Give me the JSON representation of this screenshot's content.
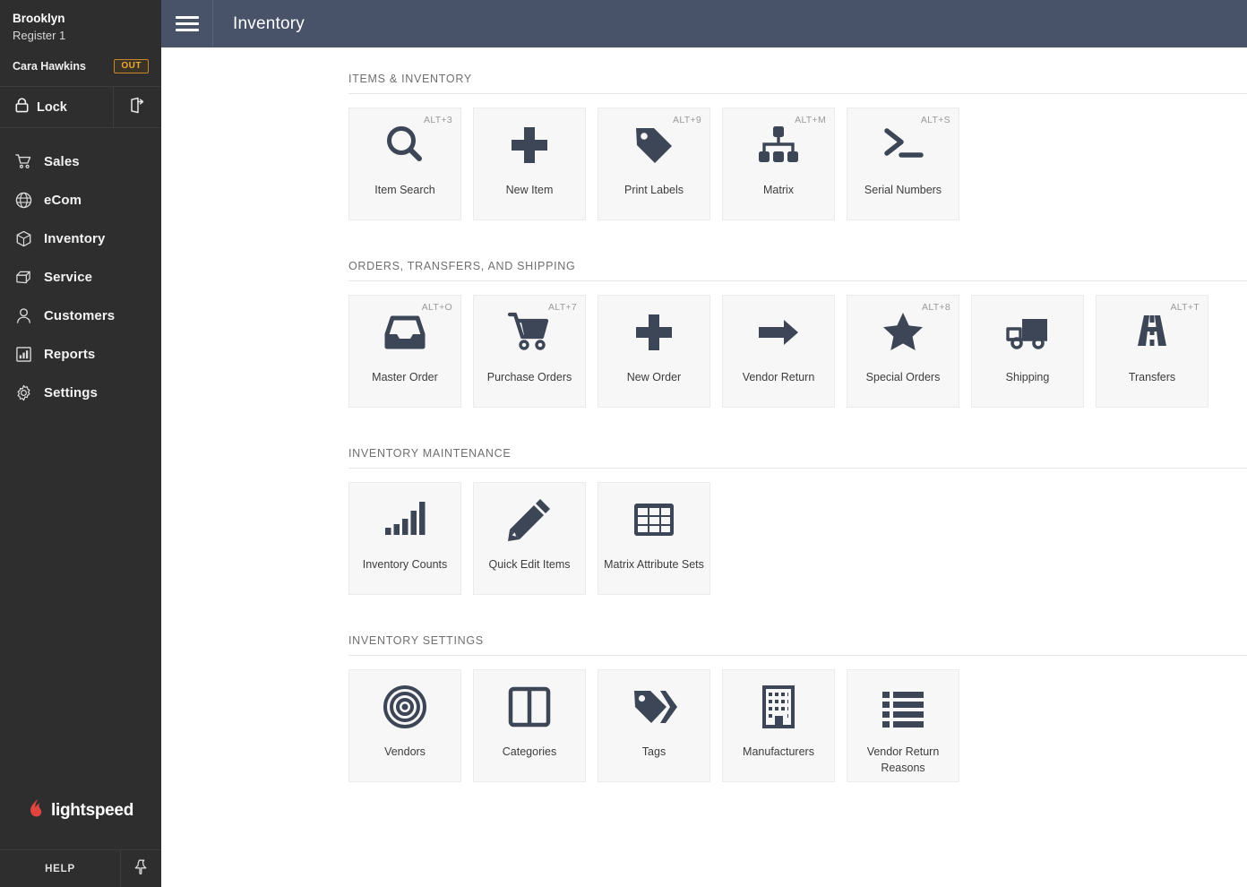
{
  "sidebar": {
    "store_name": "Brooklyn",
    "register": "Register 1",
    "user_name": "Cara Hawkins",
    "status_badge": "OUT",
    "lock_label": "Lock",
    "logout_icon": "logout-icon",
    "nav_items": [
      {
        "label": "Sales",
        "icon": "shopping-cart-icon"
      },
      {
        "label": "eCom",
        "icon": "globe-icon"
      },
      {
        "label": "Inventory",
        "icon": "box-icon"
      },
      {
        "label": "Service",
        "icon": "toolbox-icon"
      },
      {
        "label": "Customers",
        "icon": "person-icon"
      },
      {
        "label": "Reports",
        "icon": "bar-chart-icon"
      },
      {
        "label": "Settings",
        "icon": "gear-icon"
      }
    ],
    "brand": "lightspeed",
    "brand_color": "#e0443e",
    "help_label": "HELP",
    "pin_icon": "pushpin-icon"
  },
  "header": {
    "menu_icon": "hamburger-menu-icon",
    "title": "Inventory",
    "background": "#48536a"
  },
  "sections": [
    {
      "title": "ITEMS & INVENTORY",
      "tiles": [
        {
          "label": "Item Search",
          "shortcut": "ALT+3",
          "icon": "magnifier-icon"
        },
        {
          "label": "New Item",
          "shortcut": "",
          "icon": "plus-icon"
        },
        {
          "label": "Print Labels",
          "shortcut": "ALT+9",
          "icon": "tag-icon"
        },
        {
          "label": "Matrix",
          "shortcut": "ALT+M",
          "icon": "sitemap-icon"
        },
        {
          "label": "Serial Numbers",
          "shortcut": "ALT+S",
          "icon": "terminal-icon"
        }
      ]
    },
    {
      "title": "ORDERS, TRANSFERS, AND SHIPPING",
      "tiles": [
        {
          "label": "Master Order",
          "shortcut": "ALT+O",
          "icon": "inbox-tray-icon"
        },
        {
          "label": "Purchase Orders",
          "shortcut": "ALT+7",
          "icon": "shopping-cart-icon"
        },
        {
          "label": "New Order",
          "shortcut": "",
          "icon": "plus-icon"
        },
        {
          "label": "Vendor Return",
          "shortcut": "",
          "icon": "arrow-right-icon"
        },
        {
          "label": "Special Orders",
          "shortcut": "ALT+8",
          "icon": "star-icon"
        },
        {
          "label": "Shipping",
          "shortcut": "",
          "icon": "truck-icon"
        },
        {
          "label": "Transfers",
          "shortcut": "ALT+T",
          "icon": "road-icon"
        }
      ]
    },
    {
      "title": "INVENTORY MAINTENANCE",
      "tiles": [
        {
          "label": "Inventory Counts",
          "shortcut": "",
          "icon": "bar-chart-icon"
        },
        {
          "label": "Quick Edit Items",
          "shortcut": "",
          "icon": "pencil-icon"
        },
        {
          "label": "Matrix Attribute Sets",
          "shortcut": "",
          "icon": "grid-table-icon"
        }
      ]
    },
    {
      "title": "INVENTORY SETTINGS",
      "tiles": [
        {
          "label": "Vendors",
          "shortcut": "",
          "icon": "bullseye-icon"
        },
        {
          "label": "Categories",
          "shortcut": "",
          "icon": "columns-icon"
        },
        {
          "label": "Tags",
          "shortcut": "",
          "icon": "double-tag-icon"
        },
        {
          "label": "Manufacturers",
          "shortcut": "",
          "icon": "building-icon"
        },
        {
          "label": "Vendor Return Reasons",
          "shortcut": "",
          "icon": "list-icon"
        }
      ]
    }
  ]
}
